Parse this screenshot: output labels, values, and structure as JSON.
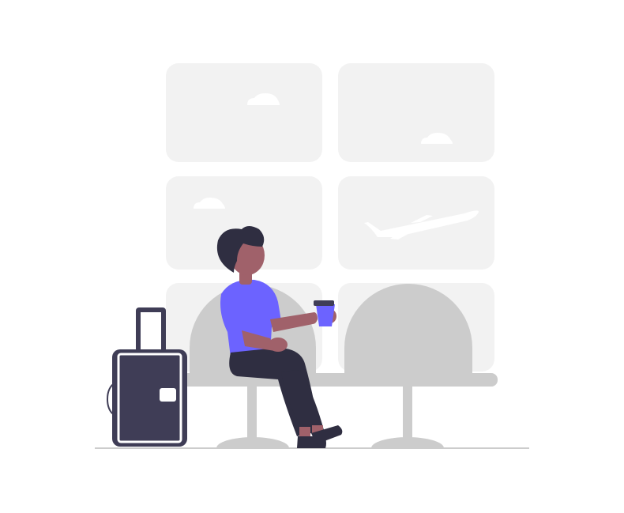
{
  "scene": {
    "subject": "person-waiting-at-airport-gate",
    "colors": {
      "background": "#ffffff",
      "window_pane": "#f2f2f2",
      "cloud": "#ffffff",
      "airplane": "#ffffff",
      "seat": "#cccccc",
      "floor_line": "#cccccc",
      "suitcase": "#3f3d56",
      "suitcase_trim": "#ffffff",
      "shirt": "#6c63ff",
      "skin": "#a0616a",
      "hair": "#2f2e41",
      "pants": "#2f2e41",
      "shoe": "#2f2e41",
      "cup": "#6c63ff",
      "cup_lid": "#3f3d56"
    },
    "icons": [
      "cloud-icon",
      "airplane-icon",
      "suitcase-icon",
      "coffee-cup-icon"
    ]
  }
}
